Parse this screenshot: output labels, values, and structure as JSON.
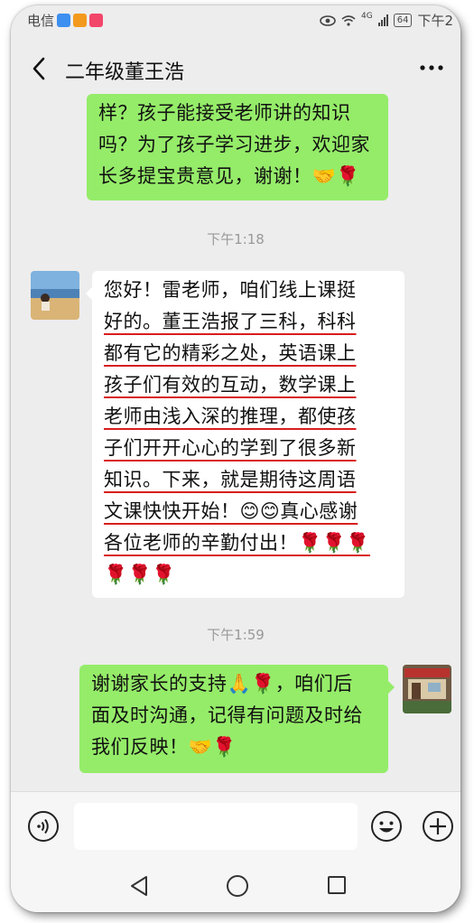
{
  "status_bar": {
    "carrier": "电信",
    "network": "4G",
    "battery": "64",
    "time": "下午2"
  },
  "header": {
    "title": "二年级董王浩",
    "back_icon": "chevron-left-icon",
    "more_icon": "more-dots-icon"
  },
  "messages": [
    {
      "side": "right",
      "lines": [
        "样？孩子能接受老师讲的知识",
        "吗？为了孩子学习进步，欢迎家",
        "长多提宝贵意见，谢谢！🤝🌹"
      ]
    },
    {
      "time": "下午1:18"
    },
    {
      "side": "left",
      "lines": [
        "您好！雷老师，咱们线上课挺",
        "好的。董王浩报了三科，科科",
        "都有它的精彩之处，英语课上",
        "孩子们有效的互动，数学课上",
        "老师由浅入深的推理，都使孩",
        "子们开开心心的学到了很多新",
        "知识。下来，就是期待这周语",
        "文课快快开始！😊😊真心感谢",
        "各位老师的辛勤付出！🌹🌹🌹",
        "🌹🌹🌹"
      ]
    },
    {
      "time": "下午1:59"
    },
    {
      "side": "right",
      "lines": [
        "谢谢家长的支持🙏🌹，咱们后",
        "面及时沟通，记得有问题及时给",
        "我们反映！🤝🌹"
      ]
    }
  ],
  "input_bar": {
    "voice_icon": "voice-icon",
    "emoji_icon": "emoji-icon",
    "plus_icon": "plus-icon"
  },
  "nav_bar": {
    "back": "nav-back-icon",
    "home": "nav-home-icon",
    "recent": "nav-recent-icon"
  },
  "colors": {
    "bubble_self": "#95ec69",
    "bubble_other": "#ffffff",
    "background": "#ededed",
    "underline": "#d81e1e"
  }
}
